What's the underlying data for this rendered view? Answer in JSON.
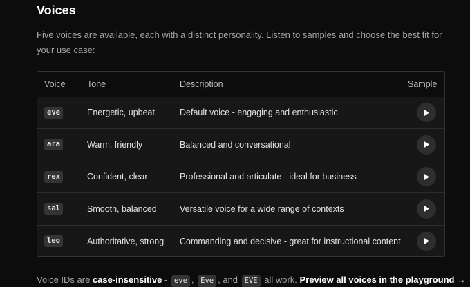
{
  "title": "Voices",
  "intro": "Five voices are available, each with a distinct personality. Listen to samples and choose the best fit for your use case:",
  "table": {
    "headers": {
      "voice": "Voice",
      "tone": "Tone",
      "description": "Description",
      "sample": "Sample"
    },
    "rows": [
      {
        "id": "eve",
        "tone": "Energetic, upbeat",
        "description": "Default voice - engaging and enthusiastic"
      },
      {
        "id": "ara",
        "tone": "Warm, friendly",
        "description": "Balanced and conversational"
      },
      {
        "id": "rex",
        "tone": "Confident, clear",
        "description": "Professional and articulate - ideal for business"
      },
      {
        "id": "sal",
        "tone": "Smooth, balanced",
        "description": "Versatile voice for a wide range of contexts"
      },
      {
        "id": "leo",
        "tone": "Authoritative, strong",
        "description": "Commanding and decisive - great for instructional content"
      }
    ],
    "play_icon": "play-icon"
  },
  "footer": {
    "prefix": "Voice IDs are ",
    "emphasis": "case-insensitive",
    "dash": " - ",
    "examples": [
      "eve",
      "Eve",
      "EVE"
    ],
    "sep1": ", ",
    "sep2": ", and ",
    "suffix": " all work. ",
    "link": "Preview all voices in the playground →"
  }
}
